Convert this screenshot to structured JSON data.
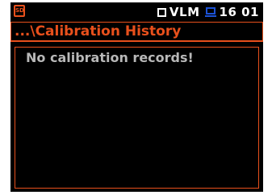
{
  "status_bar": {
    "sd_icon_label": "SD",
    "vlm_label": "VLM",
    "time": "16 01"
  },
  "title": "...\\Calibration History",
  "content": {
    "message": "No calibration records!"
  },
  "colors": {
    "accent": "#e8501c",
    "background": "#000000",
    "text": "#b8b8b8",
    "battery": "#1c52d6"
  },
  "icons": [
    "sd-card-icon",
    "checkbox-icon",
    "battery-icon"
  ]
}
